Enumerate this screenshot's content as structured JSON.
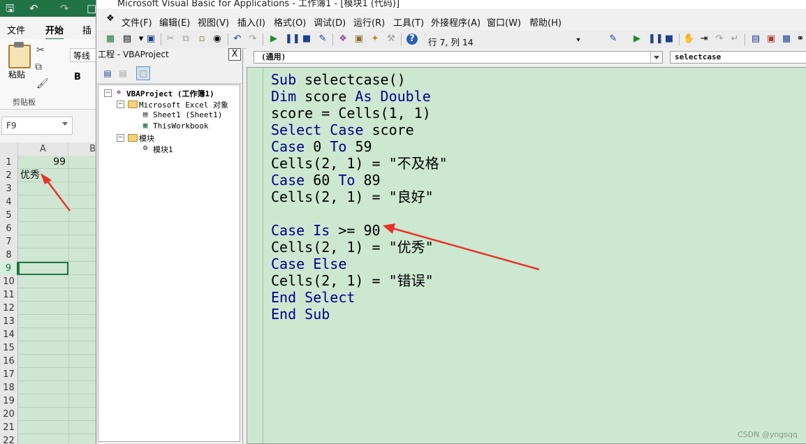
{
  "excel": {
    "tabs": [
      "文件",
      "开始",
      "插入"
    ],
    "active_tab": "开始",
    "ribbon": {
      "paste_label": "粘贴",
      "font_name": "等线",
      "bold_label": "B",
      "group_label": "剪贴板"
    },
    "name_box": "F9",
    "columns": [
      "A",
      "B"
    ],
    "cells": {
      "A1": "99",
      "A2": "优秀"
    },
    "rows": [
      "1",
      "2",
      "3",
      "4",
      "5",
      "6",
      "7",
      "8",
      "9",
      "10",
      "11",
      "12",
      "13",
      "14",
      "15",
      "16",
      "17",
      "18",
      "19",
      "20",
      "21",
      "22"
    ],
    "selected_row": "9"
  },
  "vba": {
    "title": "Microsoft Visual Basic for Applications - 工作簿1 - [模块1 (代码)]",
    "menu": [
      "文件(F)",
      "编辑(E)",
      "视图(V)",
      "插入(I)",
      "格式(O)",
      "调试(D)",
      "运行(R)",
      "工具(T)",
      "外接程序(A)",
      "窗口(W)",
      "帮助(H)"
    ],
    "position_text": "行 7, 列 14",
    "project": {
      "title": "工程 - VBAProject",
      "close_label": "X",
      "tree": {
        "root": "VBAProject (工作簿1)",
        "excel_objects": "Microsoft Excel 对象",
        "sheet1": "Sheet1 (Sheet1)",
        "workbook": "ThisWorkbook",
        "modules": "模块",
        "module1": "模块1"
      }
    },
    "code": {
      "object_dropdown": "(通用)",
      "proc_dropdown": "selectcase",
      "lines": [
        [
          {
            "t": "Sub ",
            "k": true
          },
          {
            "t": "selectcase()",
            "k": false
          }
        ],
        [
          {
            "t": "Dim ",
            "k": true
          },
          {
            "t": "score ",
            "k": false
          },
          {
            "t": "As Double",
            "k": true
          }
        ],
        [
          {
            "t": "score = Cells(1, 1)",
            "k": false
          }
        ],
        [
          {
            "t": "Select Case ",
            "k": true
          },
          {
            "t": "score",
            "k": false
          }
        ],
        [
          {
            "t": "Case ",
            "k": true
          },
          {
            "t": "0 ",
            "k": false
          },
          {
            "t": "To ",
            "k": true
          },
          {
            "t": "59",
            "k": false
          }
        ],
        [
          {
            "t": "Cells(2, 1) = \"不及格\"",
            "k": false
          }
        ],
        [
          {
            "t": "Case ",
            "k": true
          },
          {
            "t": "60 ",
            "k": false
          },
          {
            "t": "To ",
            "k": true
          },
          {
            "t": "89",
            "k": false
          }
        ],
        [
          {
            "t": "Cells(2, 1) = \"良好\"",
            "k": false
          }
        ],
        [
          {
            "t": "",
            "k": false
          }
        ],
        [
          {
            "t": "Case Is ",
            "k": true
          },
          {
            "t": ">= 90",
            "k": false
          }
        ],
        [
          {
            "t": "Cells(2, 1) = \"优秀\"",
            "k": false
          }
        ],
        [
          {
            "t": "Case Else",
            "k": true
          }
        ],
        [
          {
            "t": "Cells(2, 1) = \"错误\"",
            "k": false
          }
        ],
        [
          {
            "t": "End Select",
            "k": true
          }
        ],
        [
          {
            "t": "End Sub",
            "k": true
          }
        ]
      ]
    },
    "watermark": "CSDN @yngsqq"
  },
  "colors": {
    "excel_green": "#217346",
    "code_bg": "#cce8d0",
    "keyword": "#00008b",
    "arrow": "#e8322a"
  }
}
